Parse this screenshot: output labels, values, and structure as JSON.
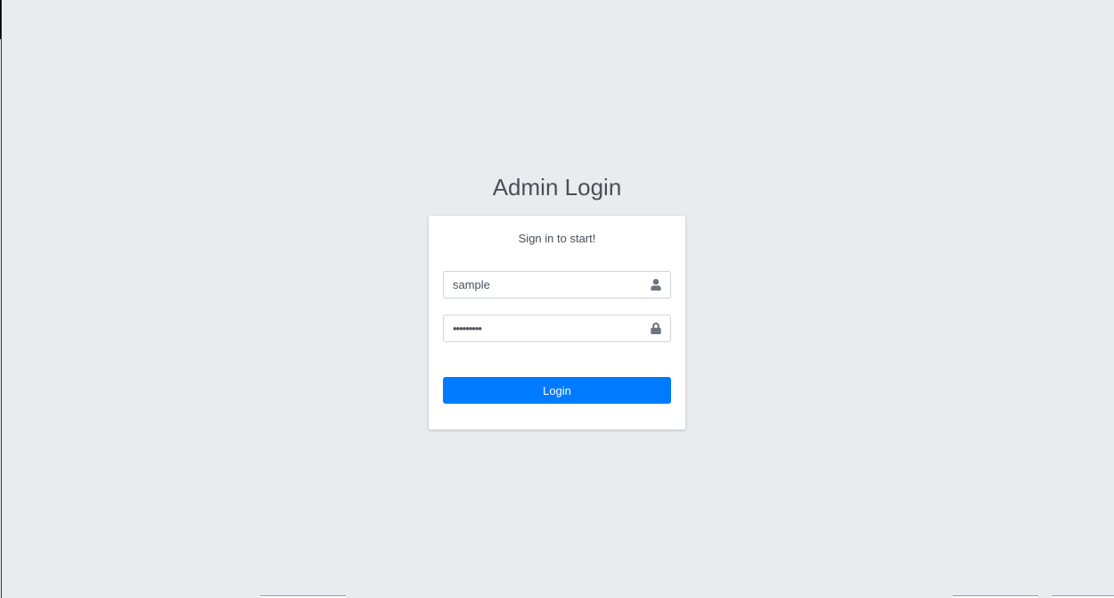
{
  "logo": {
    "bold": "Admin",
    "light": "Login"
  },
  "card": {
    "message": "Sign in to start!"
  },
  "form": {
    "username": {
      "value": "sample",
      "icon": "user-icon"
    },
    "password": {
      "value": "•••••••••",
      "icon": "lock-icon"
    },
    "submit_label": "Login"
  },
  "colors": {
    "background": "#e9ecef",
    "primary": "#007bff",
    "card": "#ffffff"
  }
}
